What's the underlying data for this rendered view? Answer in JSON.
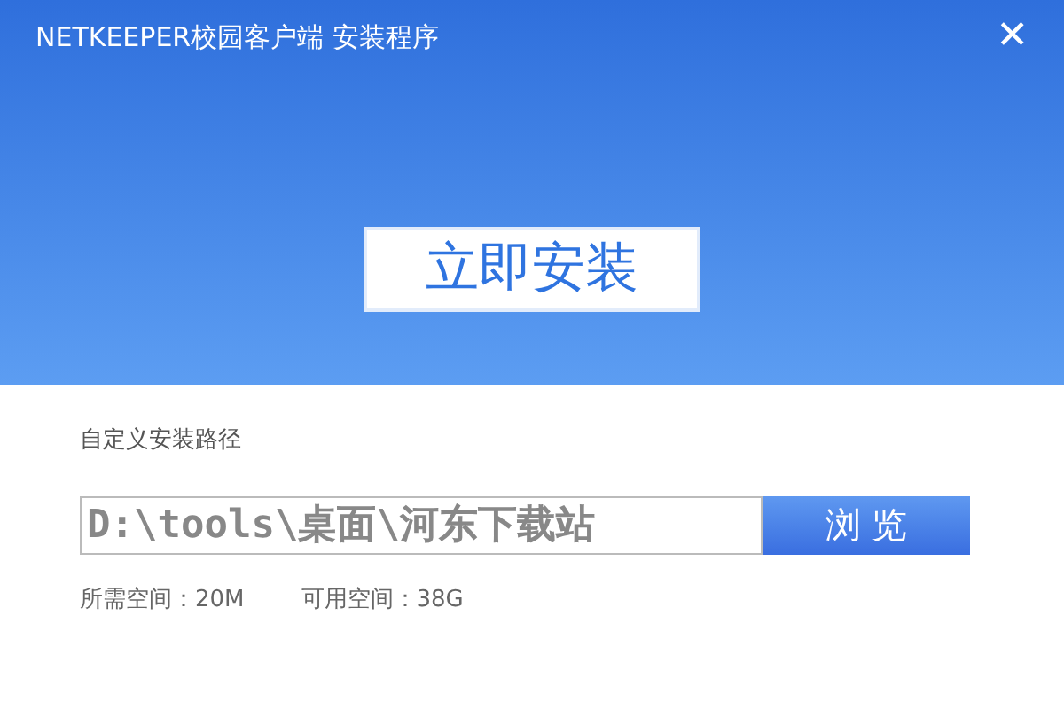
{
  "window": {
    "title": "NETKEEPER校园客户端 安装程序",
    "close": "✕"
  },
  "install_button": "立即安装",
  "path_label": "自定义安装路径",
  "path_field": {
    "value": "D:\\tools\\桌面\\河东下载站"
  },
  "browse_button": "浏 览",
  "space": [
    {
      "label": "所需空间：20M"
    },
    {
      "label": "可用空间：38G"
    }
  ]
}
